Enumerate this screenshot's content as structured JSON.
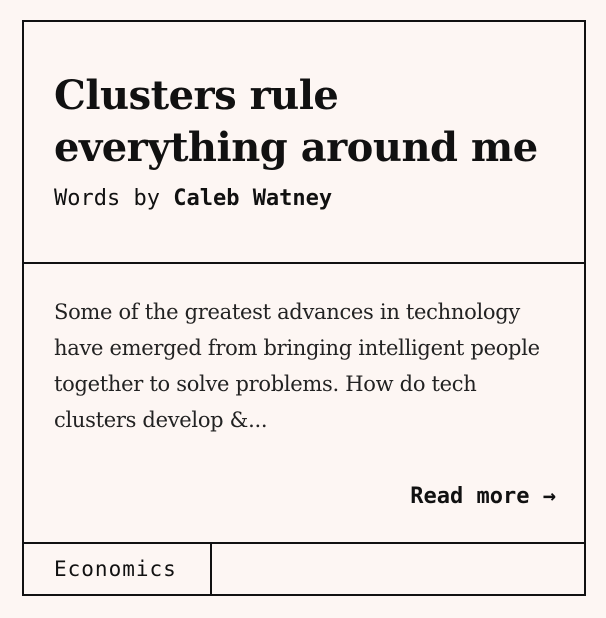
{
  "article": {
    "title": "Clusters rule everything around me",
    "byline_prefix": "Words by",
    "author": "Caleb Watney",
    "excerpt": "Some of the greatest advances in technology have emerged from bringing intelligent people together to solve problems. How do tech clusters develop &...",
    "read_more_label": "Read more →",
    "tag": "Economics"
  },
  "colors": {
    "background": "#fdf6f3",
    "border": "#111111",
    "text": "#111111"
  }
}
